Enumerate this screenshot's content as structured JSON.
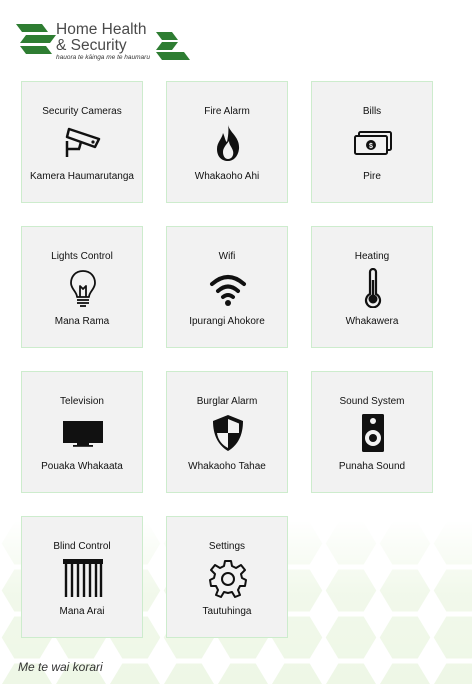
{
  "brand": {
    "title_line1": "Home Health",
    "title_line2": "& Security",
    "tagline": "hauora te kāinga me te haumaru",
    "accent_color": "#2e7d32"
  },
  "tiles": [
    {
      "label": "Security Cameras",
      "sub": "Kamera Haumarutanga",
      "icon": "security-camera-icon"
    },
    {
      "label": "Fire Alarm",
      "sub": "Whakaoho Ahi",
      "icon": "fire-icon"
    },
    {
      "label": "Bills",
      "sub": "Pire",
      "icon": "money-bills-icon"
    },
    {
      "label": "Lights Control",
      "sub": "Mana Rama",
      "icon": "light-bulb-icon"
    },
    {
      "label": "Wifi",
      "sub": "Ipurangi Ahokore",
      "icon": "wifi-icon"
    },
    {
      "label": "Heating",
      "sub": "Whakawera",
      "icon": "thermometer-icon"
    },
    {
      "label": "Television",
      "sub": "Pouaka Whakaata",
      "icon": "television-icon"
    },
    {
      "label": "Burglar Alarm",
      "sub": "Whakaoho Tahae",
      "icon": "shield-icon"
    },
    {
      "label": "Sound System",
      "sub": "Punaha Sound",
      "icon": "speaker-icon"
    },
    {
      "label": "Blind Control",
      "sub": "Mana Arai",
      "icon": "window-blind-icon"
    },
    {
      "label": "Settings",
      "sub": "Tautuhinga",
      "icon": "gear-icon"
    }
  ],
  "footer": {
    "text": "Me te wai korari"
  }
}
